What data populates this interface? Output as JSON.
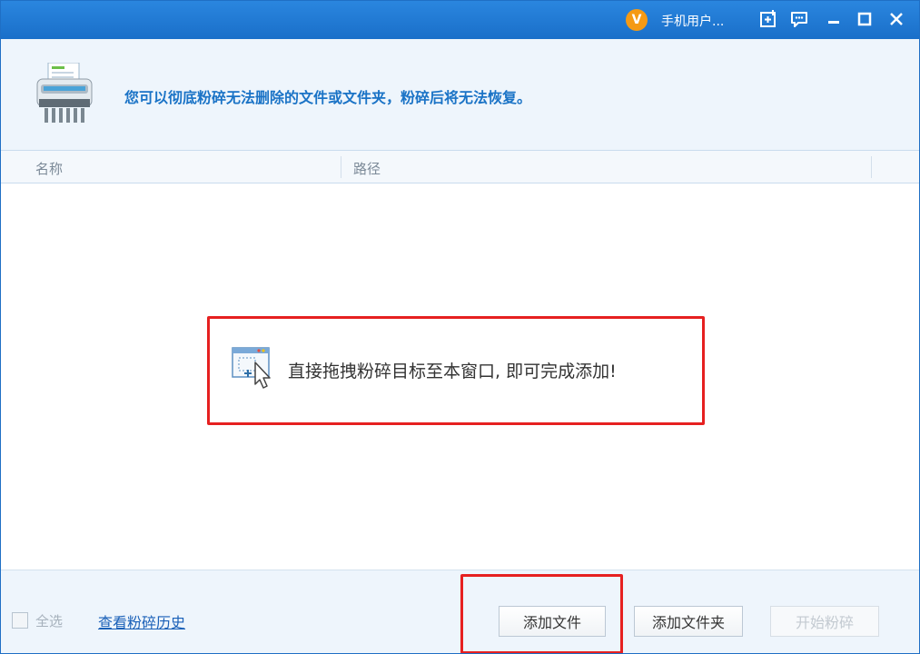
{
  "titlebar": {
    "vip_badge": "V",
    "user_name": "手机用户...",
    "icons": [
      "add-icon",
      "feedback-icon",
      "minimize-icon",
      "maximize-icon",
      "close-icon"
    ]
  },
  "header": {
    "description": "您可以彻底粉碎无法删除的文件或文件夹，粉碎后将无法恢复。"
  },
  "columns": [
    "名称",
    "路径"
  ],
  "list": {
    "drop_hint": "直接拖拽粉碎目标至本窗口, 即可完成添加!"
  },
  "footer": {
    "select_all_label": "全选",
    "history_link": "查看粉碎历史",
    "add_file_button": "添加文件",
    "add_folder_button": "添加文件夹",
    "start_button": "开始粉碎"
  },
  "colors": {
    "accent": "#1a73c6",
    "titlebar": "#1f75d0",
    "highlight": "#e62020"
  }
}
